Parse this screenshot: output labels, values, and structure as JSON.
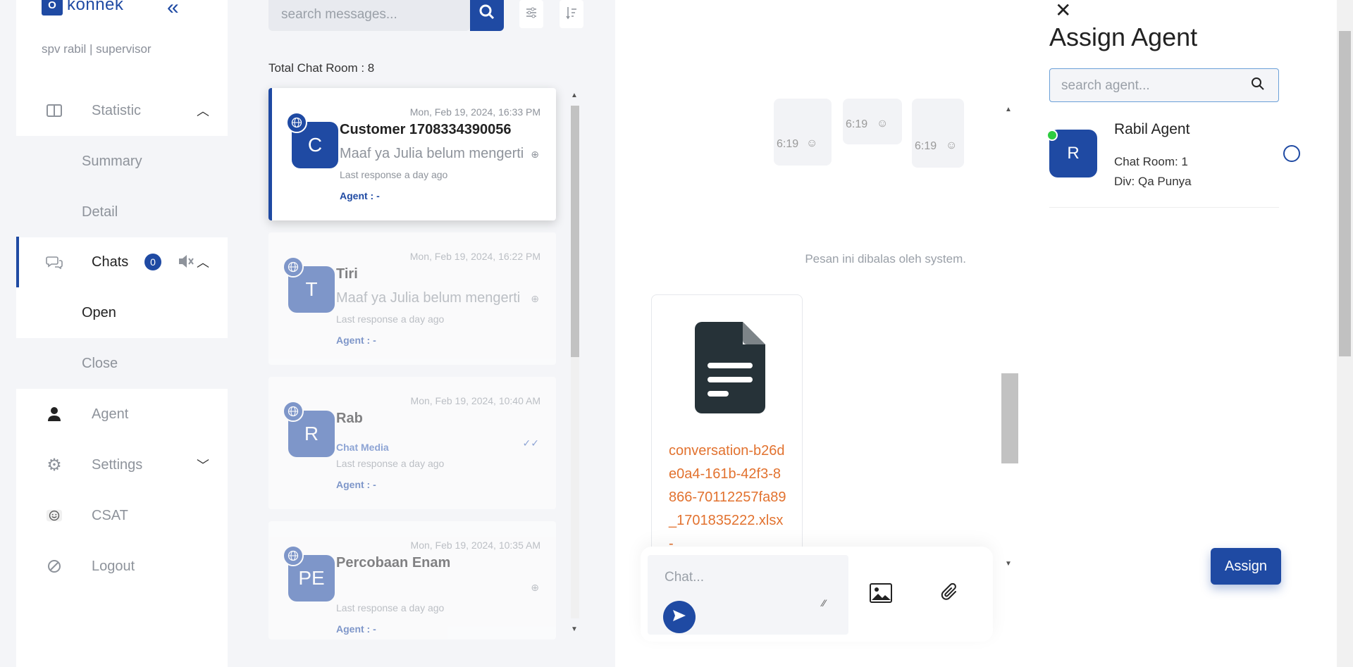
{
  "sidebar": {
    "logo_mark": "O",
    "logo_text": "konnek",
    "user": "spv rabil | supervisor",
    "items": [
      {
        "label": "Statistic",
        "icon": "book-open-icon"
      },
      {
        "label": "Summary"
      },
      {
        "label": "Detail"
      },
      {
        "label": "Chats",
        "badge": "0",
        "icon": "chat-bubbles-icon"
      },
      {
        "label": "Open"
      },
      {
        "label": "Close"
      },
      {
        "label": "Agent",
        "icon": "person-icon"
      },
      {
        "label": "Settings",
        "icon": "gear-icon"
      },
      {
        "label": "CSAT",
        "icon": "smiley-icon"
      },
      {
        "label": "Logout",
        "icon": "ban-icon"
      }
    ]
  },
  "chatlist": {
    "search_placeholder": "search messages...",
    "total": "Total Chat Room : 8",
    "rooms": [
      {
        "initials": "C",
        "date": "Mon, Feb 19, 2024, 16:33 PM",
        "name": "Customer 1708334390056",
        "message": "Maaf ya Julia belum mengerti",
        "last": "Last response a day ago",
        "agent": "Agent : -"
      },
      {
        "initials": "T",
        "date": "Mon, Feb 19, 2024, 16:22 PM",
        "name": "Tiri",
        "message": "Maaf ya Julia belum mengerti",
        "last": "Last response a day ago",
        "agent": "Agent : -"
      },
      {
        "initials": "R",
        "date": "Mon, Feb 19, 2024, 10:40 AM",
        "name": "Rab",
        "media": "Chat Media",
        "last": "Last response a day ago",
        "agent": "Agent : -"
      },
      {
        "initials": "PE",
        "date": "Mon, Feb 19, 2024, 10:35 AM",
        "name": "Percobaan Enam",
        "last": "Last response a day ago",
        "agent": "Agent : -"
      }
    ]
  },
  "conversation": {
    "times": [
      "6:19",
      "6:19",
      "6:19"
    ],
    "system_note": "Pesan ini dibalas oleh system.",
    "file_name": "conversation-b26de0a4-161b-42f3-8866-70112257fa89_1701835222.xlsx -",
    "chat_placeholder": "Chat..."
  },
  "assign": {
    "title": "Assign Agent",
    "search_placeholder": "search agent...",
    "agent": {
      "initial": "R",
      "name": "Rabil Agent",
      "room": "Chat Room: 1",
      "div": "Div: Qa Punya"
    },
    "button": "Assign"
  },
  "colors": {
    "brand": "#1f4aa3",
    "file_link": "#e2722f",
    "online": "#2ecc40"
  }
}
